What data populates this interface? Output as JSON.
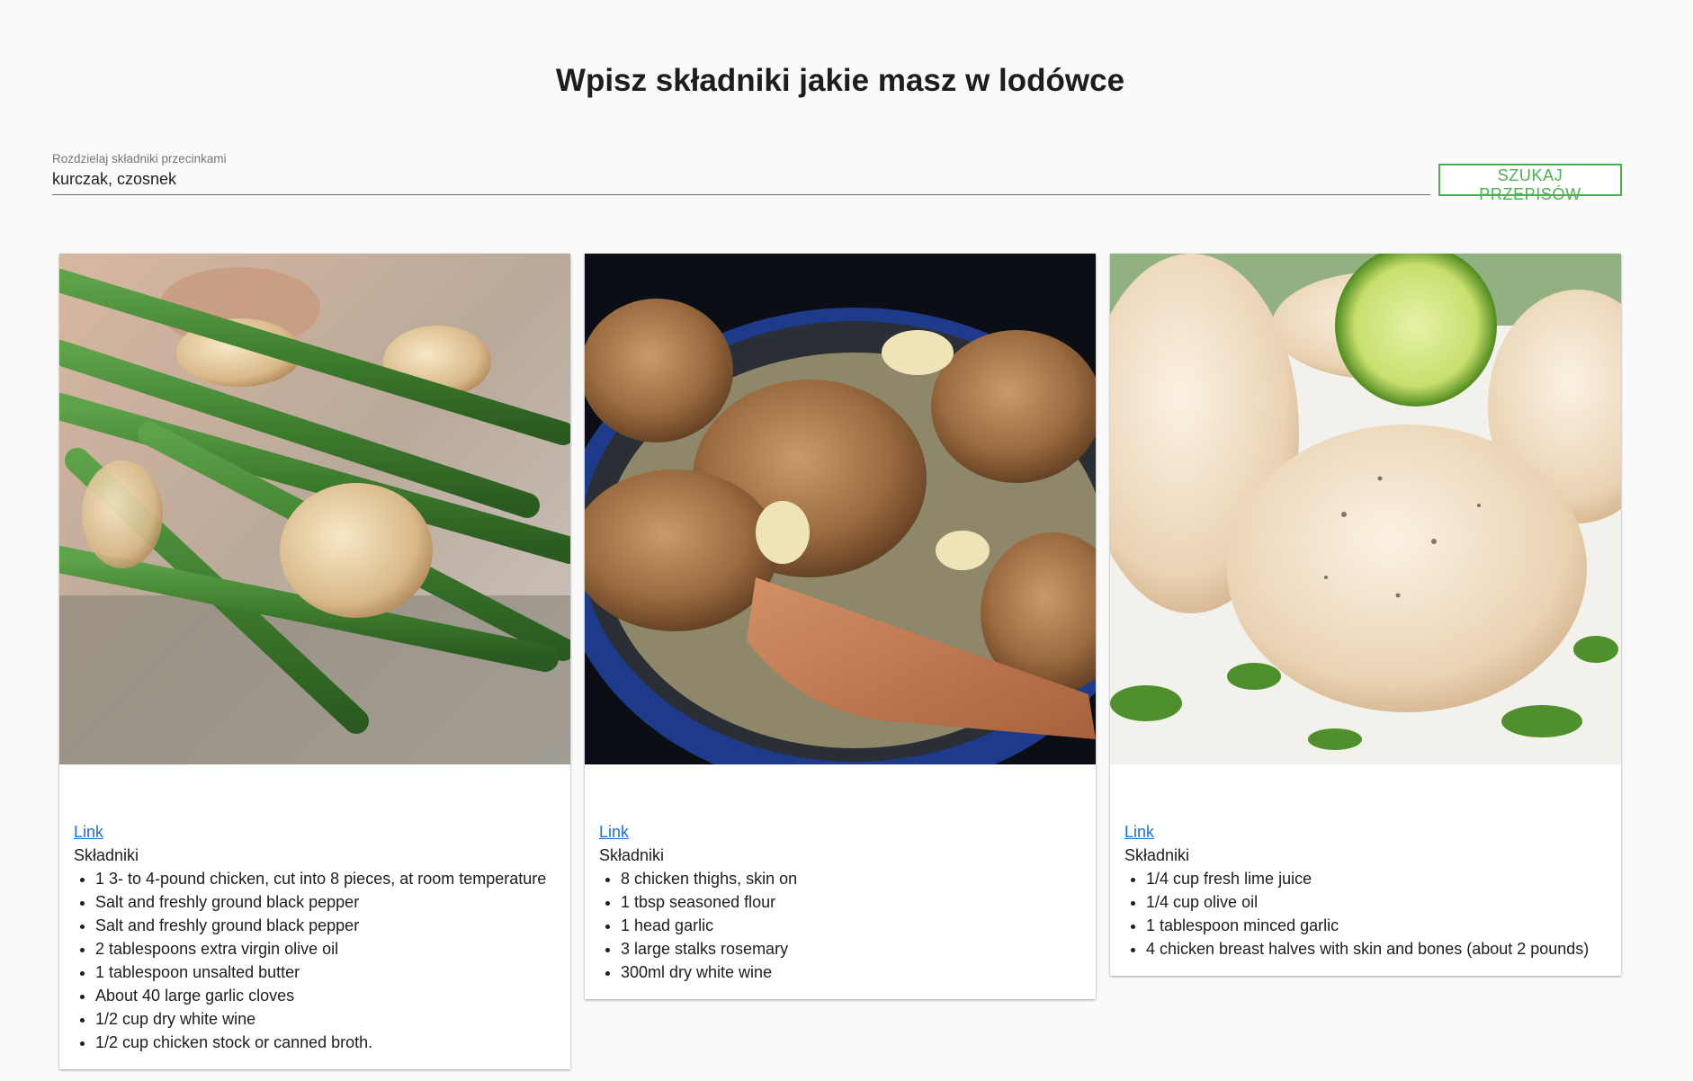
{
  "header": {
    "title": "Wpisz składniki jakie masz w lodówce"
  },
  "search": {
    "label": "Rozdzielaj składniki przecinkami",
    "value": "kurczak, czosnek",
    "button_label": "SZUKAJ PRZEPISÓW"
  },
  "colors": {
    "accent": "#4caf50",
    "link": "#1e6fd0",
    "background": "#fafafa"
  },
  "recipes": [
    {
      "image": "green-beans-garlic-photo",
      "link_label": "Link",
      "ingredients_heading": "Składniki",
      "ingredients": [
        "1 3- to 4-pound chicken, cut into 8 pieces, at room temperature",
        "Salt and freshly ground black pepper",
        "Salt and freshly ground black pepper",
        "2 tablespoons extra virgin olive oil",
        "1 tablespoon unsalted butter",
        "About 40 large garlic cloves",
        "1/2 cup dry white wine",
        "1/2 cup chicken stock or canned broth."
      ]
    },
    {
      "image": "chicken-thighs-pan-photo",
      "link_label": "Link",
      "ingredients_heading": "Składniki",
      "ingredients": [
        "8 chicken thighs, skin on",
        "1 tbsp seasoned flour",
        "1 head garlic",
        "3 large stalks rosemary",
        "300ml dry white wine"
      ]
    },
    {
      "image": "chicken-breast-lime-photo",
      "link_label": "Link",
      "ingredients_heading": "Składniki",
      "ingredients": [
        "1/4 cup fresh lime juice",
        "1/4 cup olive oil",
        "1 tablespoon minced garlic",
        "4 chicken breast halves with skin and bones (about 2 pounds)"
      ]
    }
  ]
}
